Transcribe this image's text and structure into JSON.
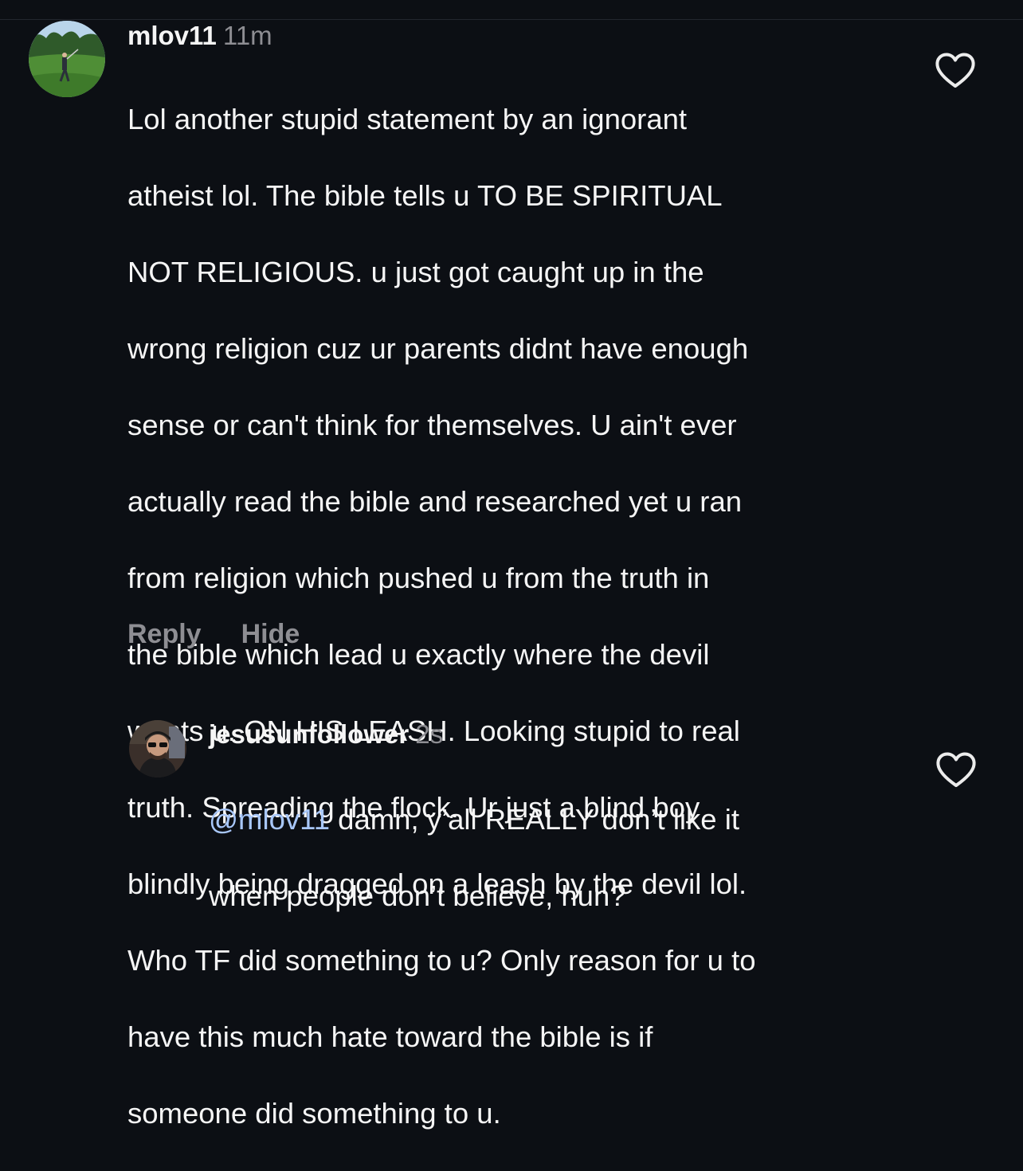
{
  "comments": [
    {
      "username": "mlov11",
      "time": "11m",
      "text_lines": [
        "Lol another stupid statement by an ignorant",
        "atheist lol. The bible tells u TO BE SPIRITUAL",
        "NOT RELIGIOUS. u just got caught up in the",
        "wrong religion cuz ur parents didnt have enough",
        "sense or can't think for themselves. U ain't ever",
        "actually read the bible and researched yet u ran",
        "from religion which pushed u from the truth in",
        "the bible which lead u exactly where the devil",
        "wants u. ON HIS LEASH. Looking stupid to real",
        "truth. Spreading the flock. Ur just a blind boy",
        "blindly being dragged on a leash by the devil lol.",
        "Who TF did something to u? Only reason for u to",
        "have this much hate toward the bible is if",
        "someone did something to u."
      ],
      "reply_label": "Reply",
      "hide_label": "Hide",
      "like_icon": "heart-outline-icon"
    },
    {
      "username": "jesusunfollower",
      "time": "2s",
      "mention": "@mlov11",
      "text_line1_rest": " damn, y’all REALLY don’t like it",
      "text_line2": "when people don’t believe, huh?",
      "like_icon": "heart-outline-icon"
    }
  ],
  "colors": {
    "background": "#0c0f14",
    "text": "#f5f5f5",
    "secondary": "#8e8e93",
    "mention": "#a8c7fa"
  }
}
